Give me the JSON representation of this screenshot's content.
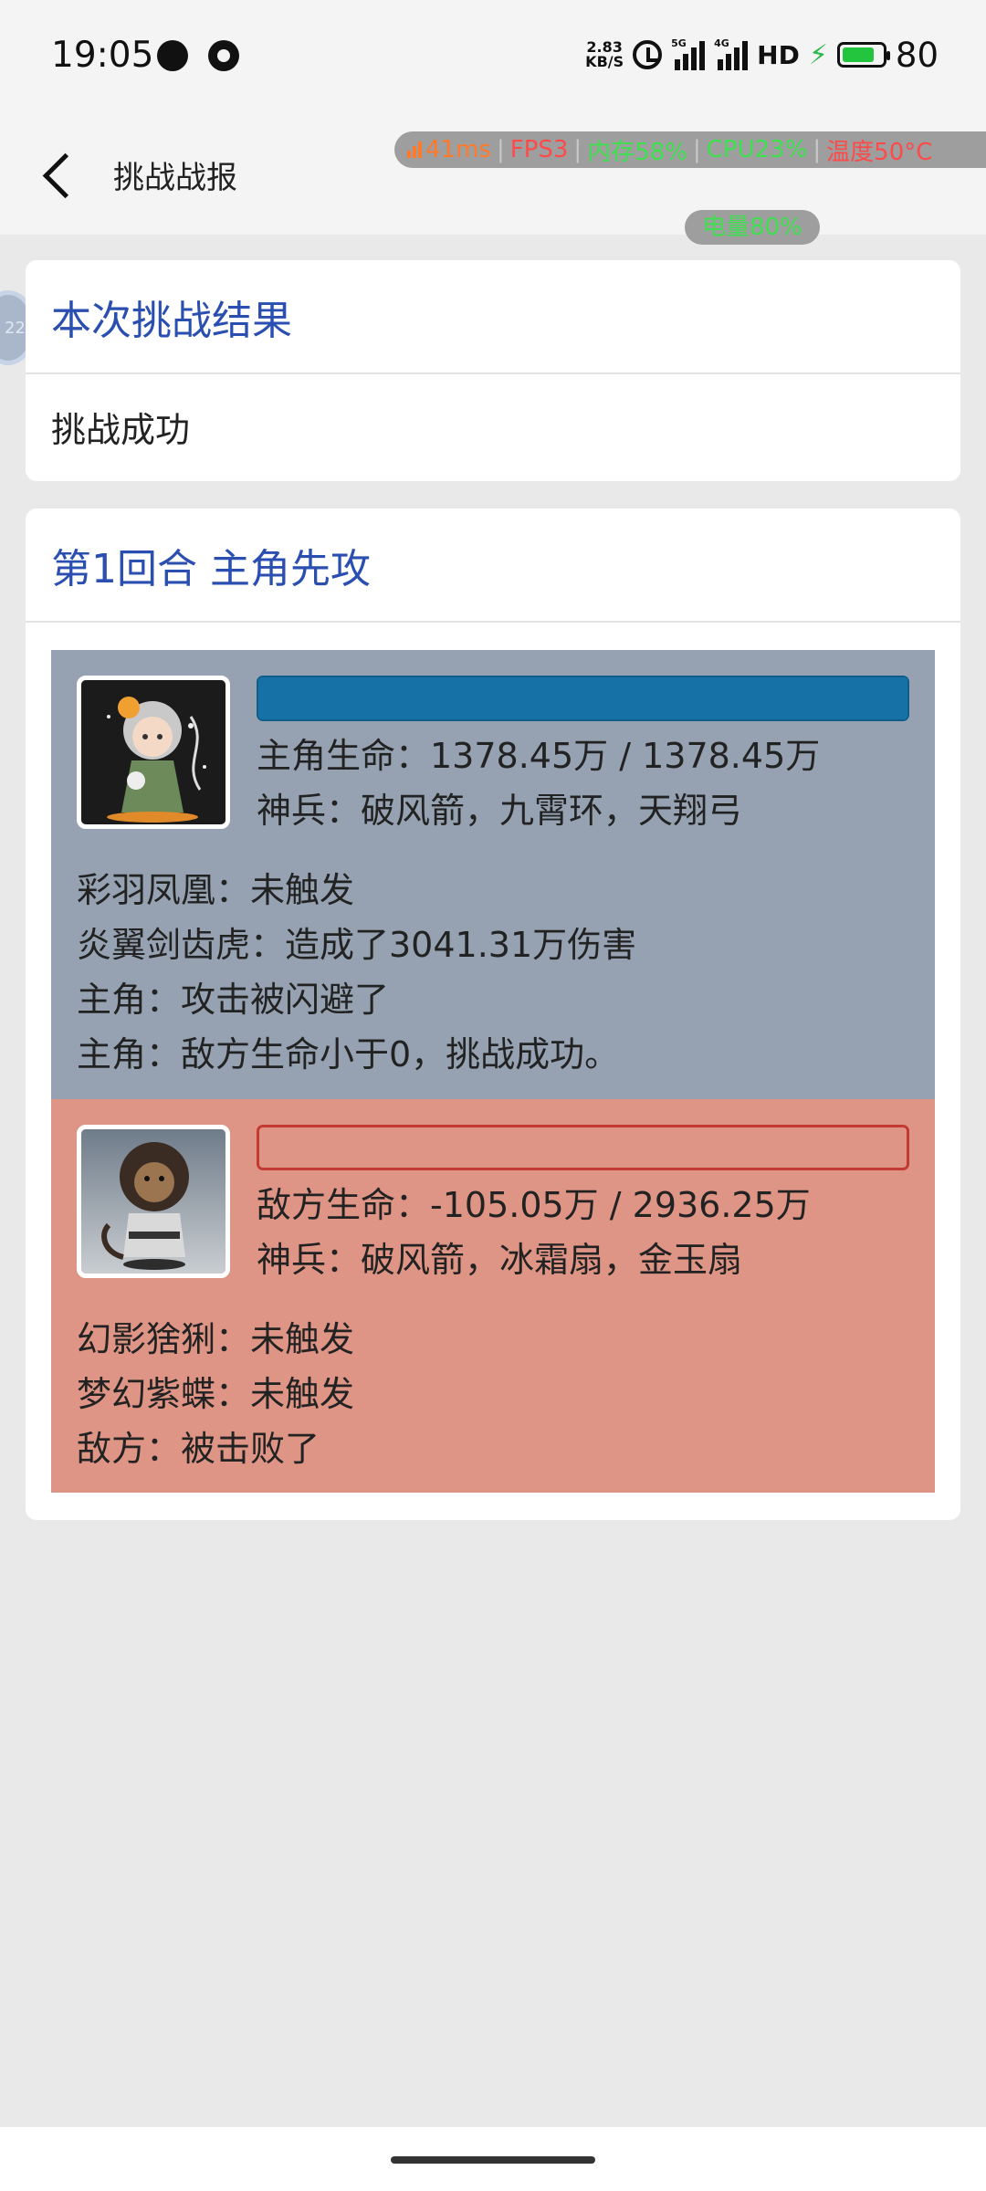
{
  "status_bar": {
    "time": "19:05",
    "net_speed_value": "2.83",
    "net_speed_unit": "KB/S",
    "signal1_tag": "5G",
    "signal2_tag": "4G",
    "hd_label": "HD",
    "battery_level": 0.8,
    "battery_percent": "80",
    "battery_fill_color": "#23c43e"
  },
  "header": {
    "title": "挑战战报"
  },
  "perf_overlay": {
    "latency": "41ms",
    "fps": "FPS3",
    "memory": "内存58%",
    "cpu": "CPU23%",
    "temperature": "温度50°C",
    "battery": "电量80%"
  },
  "floating_ball": {
    "text": "22"
  },
  "result_card": {
    "title": "本次挑战结果",
    "result": "挑战成功"
  },
  "round_card": {
    "title": "第1回合 主角先攻",
    "hero": {
      "hp_text": "主角生命：1378.45万 / 1378.45万",
      "hp_fraction": 1.0,
      "weapons": "神兵：破风箭，九霄环，天翔弓",
      "log": [
        "彩羽凤凰：未触发",
        "炎翼剑齿虎：造成了3041.31万伤害",
        "主角：攻击被闪避了",
        "主角：敌方生命小于0，挑战成功。"
      ]
    },
    "enemy": {
      "hp_text": "敌方生命：-105.05万 / 2936.25万",
      "hp_fraction": 0.0,
      "weapons": "神兵：破风箭，冰霜扇，金玉扇",
      "log": [
        "幻影猞猁：未触发",
        "梦幻紫蝶：未触发",
        "敌方：被击败了"
      ]
    }
  },
  "colors": {
    "accent_title": "#2a4fb0",
    "hero_panel": "#96a2b1",
    "enemy_panel": "#df9585",
    "hero_hp_bar": "#1672a6",
    "enemy_hp_border": "#c33a33"
  }
}
